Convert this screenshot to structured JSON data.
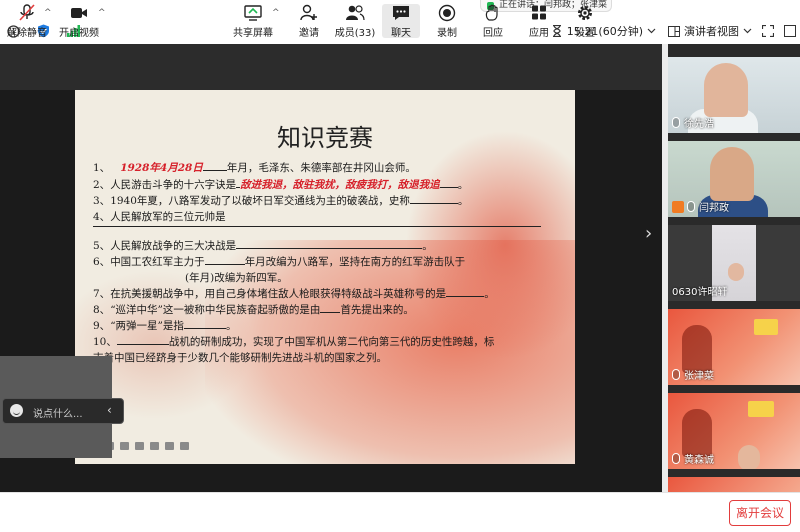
{
  "top_bar": {
    "active_speaker": "正在讲话：闫邦政；张津菜",
    "meeting_time": "15:21(60分钟)",
    "view_label": "演讲者视图"
  },
  "slide": {
    "title": "知识竞赛",
    "questions": [
      {
        "num": "1、",
        "answer": "1928年4月28日",
        "text": "年月，毛泽东、朱德率部在井冈山会师。"
      },
      {
        "num": "2、",
        "text_before": "人民游击斗争的十六字诀是",
        "answer": "敌进我退，敌驻我扰，敌疲我打，敌退我追",
        "text_after": "。"
      },
      {
        "num": "3、",
        "text": "1940年夏，八路军发动了以破坏日军交通线为主的破袭战，史称",
        "text_after": "。"
      },
      {
        "num": "4、",
        "text": "人民解放军的三位元帅是"
      },
      {
        "num": "5、",
        "text": "人民解放战争的三大决战是",
        "text_after": "。"
      },
      {
        "num": "6、",
        "text_before": "中国工农红军主力于",
        "text_mid": "年月改编为八路军，坚持在南方的红军游击队于"
      },
      {
        "num": "",
        "text": "(年月)改编为新四军。"
      },
      {
        "num": "7、",
        "text": "在抗美援朝战争中，用自己身体堵住敌人枪眼获得特级战斗英雄称号的是",
        "text_after": "。"
      },
      {
        "num": "8、",
        "text_before": "“巡洋中华”这一被称中华民族奋起骄傲的是由",
        "text_after": "首先提出来的。"
      },
      {
        "num": "9、",
        "text_before": "“两弹一星”是指",
        "text_after": "。"
      },
      {
        "num": "10、",
        "text": "战机的研制成功，实现了中国军机从第二代向第三代的历史性跨越，标"
      },
      {
        "num": "",
        "text": "志着中国已经跻身于少数几个能够研制先进战斗机的国家之列。"
      }
    ]
  },
  "chat": {
    "placeholder": "说点什么..."
  },
  "participants": [
    {
      "name": "徐先浩",
      "muted": false,
      "host": false,
      "active": false
    },
    {
      "name": "闫邦政",
      "muted": false,
      "host": true,
      "active": true
    },
    {
      "name": "0630许昭轩",
      "muted": false,
      "host": false,
      "active": false
    },
    {
      "name": "张津菜",
      "muted": false,
      "host": false,
      "active": false
    },
    {
      "name": "黄森诚",
      "muted": false,
      "host": false,
      "active": false
    }
  ],
  "toolbar": {
    "mute": "解除静音",
    "video": "开启视频",
    "share": "共享屏幕",
    "invite": "邀请",
    "members": "成员(33)",
    "chat": "聊天",
    "record": "录制",
    "reaction": "回应",
    "apps": "应用",
    "settings": "设置",
    "leave": "离开会议"
  },
  "colors": {
    "accent_green": "#1fb853",
    "answer_red": "#d6202a",
    "leave_red": "#e23d3d",
    "host_orange": "#f07b22"
  }
}
